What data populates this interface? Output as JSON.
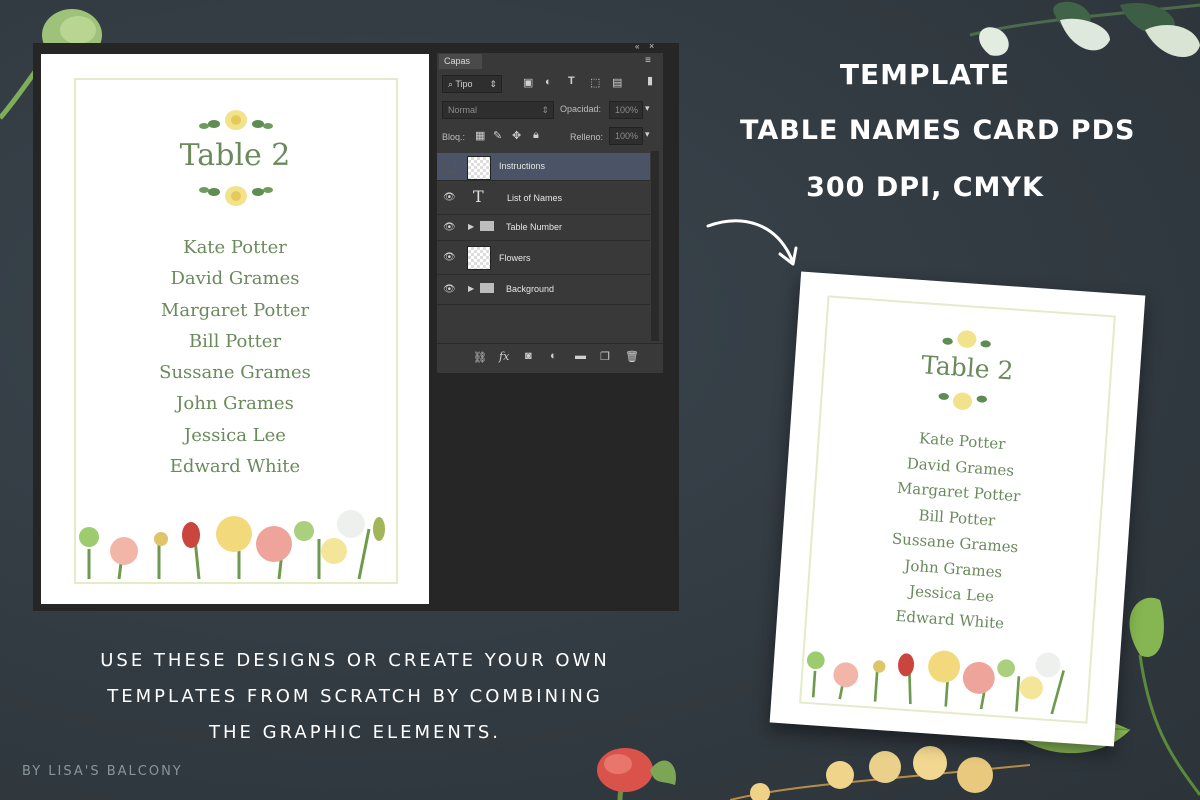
{
  "card": {
    "title": "Table 2",
    "names": [
      "Kate Potter",
      "David Grames",
      "Margaret Potter",
      "Bill Potter",
      "Sussane Grames",
      "John Grames",
      "Jessica Lee",
      "Edward White"
    ]
  },
  "layers_panel": {
    "tab_label": "Capas",
    "filter_value": "Tipo",
    "blend_mode": "Normal",
    "opacity_label": "Opacidad:",
    "opacity_value": "100%",
    "lock_label": "Bloq.:",
    "fill_label": "Relleno:",
    "fill_value": "100%",
    "layers": [
      {
        "name": "Instructions",
        "kind": "raster",
        "selected": true,
        "visible": false
      },
      {
        "name": "List of Names",
        "kind": "text",
        "selected": false,
        "visible": true
      },
      {
        "name": "Table Number",
        "kind": "group",
        "selected": false,
        "visible": true
      },
      {
        "name": "Flowers",
        "kind": "raster",
        "selected": false,
        "visible": true
      },
      {
        "name": "Background",
        "kind": "group",
        "selected": false,
        "visible": true
      }
    ]
  },
  "headline": {
    "line1": "TEMPLATE",
    "line2": "TABLE NAMES CARD PDS",
    "line3": "300 DPI, CMYK"
  },
  "caption": {
    "line1": "USE THESE DESIGNS OR CREATE YOUR OWN",
    "line2": "TEMPLATES FROM SCRATCH BY COMBINING",
    "line3": "THE GRAPHIC ELEMENTS."
  },
  "credit": "BY LISA'S BALCONY",
  "colors": {
    "background": "#343d44",
    "card_text": "#6a8a5c",
    "card_border": "#e4ebc8",
    "selected_layer": "#4b5366"
  }
}
